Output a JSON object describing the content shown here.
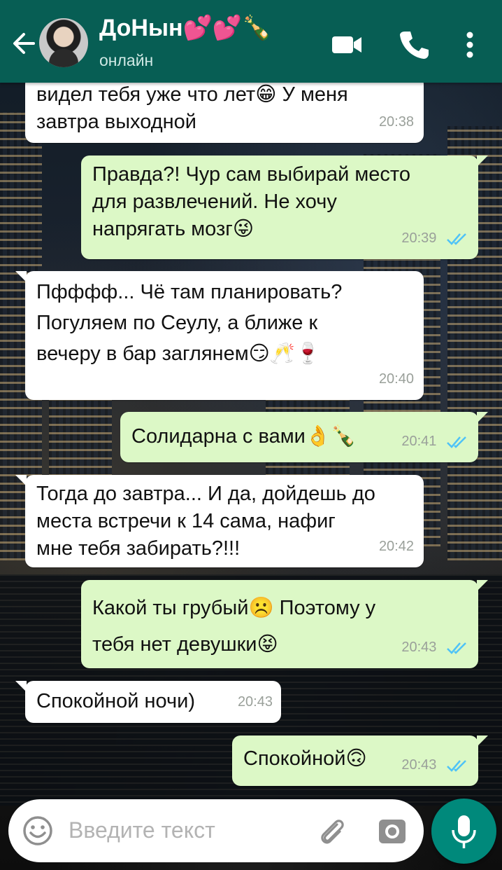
{
  "header": {
    "contact_name": "ДоНын💕💕🍾",
    "status": "онлайн"
  },
  "messages": [
    {
      "dir": "in",
      "text": "видел тебя уже что лет😁 У меня\nзавтра выходной",
      "time": "20:38"
    },
    {
      "dir": "out",
      "text": "Правда?! Чур сам выбирай место\nдля развлечений. Не хочу\nнапрягать мозг😜",
      "time": "20:39",
      "read": true
    },
    {
      "dir": "in",
      "text": "Пфффф... Чё там планировать?\nПогуляем по Сеулу, а ближе к\nвечеру в бар заглянем😏🥂🍷",
      "time": "20:40"
    },
    {
      "dir": "out",
      "text": "Солидарна с вами👌🍾",
      "time": "20:41",
      "read": true
    },
    {
      "dir": "in",
      "text": "Тогда до завтра... И да, дойдешь до\nместа встречи к 14 сама, нафиг\nмне тебя забирать?!!!",
      "time": "20:42"
    },
    {
      "dir": "out",
      "text": "Какой ты грубый☹️ Поэтому у\nтебя нет девушки😝",
      "time": "20:43",
      "read": true
    },
    {
      "dir": "in",
      "text": "Спокойной ночи)",
      "time": "20:43"
    },
    {
      "dir": "out",
      "text": "Спокойной🙃",
      "time": "20:43",
      "read": true
    }
  ],
  "composer": {
    "placeholder": "Введите текст"
  },
  "colors": {
    "header": "#075e54",
    "incoming_bubble": "#ffffff",
    "outgoing_bubble": "#dcf8c6",
    "read_ticks": "#4fc3f7",
    "mic_button": "#00897b"
  },
  "icons": {
    "back": "arrow-left-icon",
    "video": "video-camera-icon",
    "call": "phone-icon",
    "menu": "more-vertical-icon",
    "emoji": "smiley-icon",
    "attach": "paperclip-icon",
    "camera": "camera-icon",
    "mic": "microphone-icon"
  }
}
